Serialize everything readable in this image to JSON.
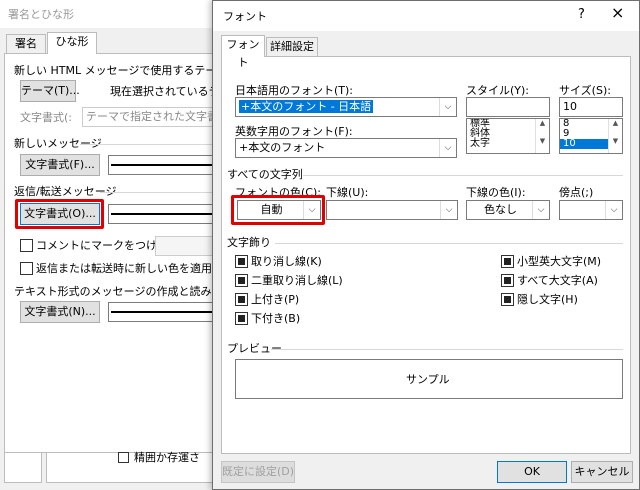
{
  "back": {
    "title": "署名とひな形",
    "tabs": [
      "署名",
      "ひな形"
    ],
    "theme_group": "新しい HTML メッセージで使用するテーマ",
    "theme_button": "テーマ(T)...",
    "theme_status": "現在選択されているテ マ",
    "font_label": "文字書式(:",
    "font_placeholder": "テーマで指定された文字書式を使",
    "new_msg_group": "新しいメッセージ",
    "new_msg_font_btn": "文字書式(F)...",
    "reply_group": "返信/転送メッセージ",
    "reply_font_btn": "文字書式(O)...",
    "mark_comments_label": "コメントにマークをつける(M):",
    "pick_color_label": "返信または転送時に新しい色を適用する(C)",
    "plain_group": "テキスト形式のメッセージの作成と読み込み",
    "plain_font_btn": "文字書式(N)...",
    "stationery_hint": "精囲か存運さ"
  },
  "dialog": {
    "title": "フォント",
    "help_icon": "?",
    "close_icon": "×",
    "tabs": [
      "フォント",
      "詳細設定"
    ],
    "jp_font_label": "日本語用のフォント(T):",
    "jp_font_value": "+本文のフォント - 日本語",
    "en_font_label": "英数字用のフォント(F):",
    "en_font_value": "+本文のフォント",
    "style_label": "スタイル(Y):",
    "style_items": [
      "標準",
      "斜体",
      "太字"
    ],
    "size_label": "サイズ(S):",
    "size_value": "10",
    "size_items": [
      "8",
      "9",
      "10"
    ],
    "all_text_group": "すべての文字列",
    "font_color_label": "フォントの色(C):",
    "font_color_value": "自動",
    "underline_label": "下線(U):",
    "underline_color_label": "下線の色(I):",
    "underline_color_value": "色なし",
    "emphasis_label": "傍点(;)",
    "effects_group": "文字飾り",
    "effects": {
      "strike": "取り消し線(K)",
      "double_strike": "二重取り消し線(L)",
      "superscript": "上付き(P)",
      "subscript": "下付き(B)",
      "small_caps": "小型英大文字(M)",
      "all_caps": "すべて大文字(A)",
      "hidden": "隠し文字(H)"
    },
    "preview_group": "プレビュー",
    "preview_text": "サンプル",
    "default_btn": "既定に設定(D)",
    "ok_btn": "OK",
    "cancel_btn": "キャンセル"
  },
  "colors": {
    "accent": "#0078d7",
    "highlight_red": "#e00000"
  }
}
